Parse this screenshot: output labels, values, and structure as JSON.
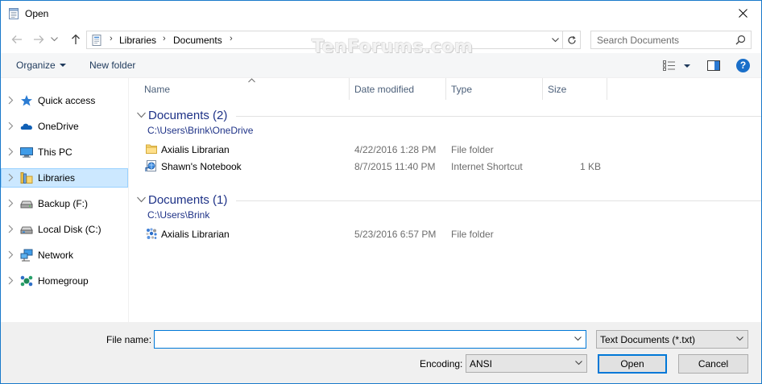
{
  "window": {
    "title": "Open",
    "close_icon": "close-icon"
  },
  "nav": {
    "back_icon": "arrow-left-icon",
    "forward_icon": "arrow-right-icon",
    "recent_icon": "chevron-down-icon",
    "up_icon": "arrow-up-icon",
    "breadcrumb": [
      "Libraries",
      "Documents"
    ],
    "refresh_icon": "refresh-icon",
    "search_placeholder": "Search Documents"
  },
  "watermark": "TenForums.com",
  "toolbar": {
    "organize": "Organize",
    "new_folder": "New folder"
  },
  "sidebar": {
    "items": [
      {
        "label": "Quick access",
        "icon": "star-icon"
      },
      {
        "label": "OneDrive",
        "icon": "cloud-icon"
      },
      {
        "label": "This PC",
        "icon": "computer-icon"
      },
      {
        "label": "Libraries",
        "icon": "library-icon",
        "selected": true
      },
      {
        "label": "Backup (F:)",
        "icon": "drive-icon"
      },
      {
        "label": "Local Disk (C:)",
        "icon": "drive-icon"
      },
      {
        "label": "Network",
        "icon": "network-icon"
      },
      {
        "label": "Homegroup",
        "icon": "homegroup-icon"
      }
    ]
  },
  "columns": [
    "Name",
    "Date modified",
    "Type",
    "Size"
  ],
  "groups": [
    {
      "title": "Documents (2)",
      "path": "C:\\Users\\Brink\\OneDrive",
      "rows": [
        {
          "name": "Axialis Librarian",
          "date": "4/22/2016 1:28 PM",
          "type": "File folder",
          "size": "",
          "icon": "folder-icon"
        },
        {
          "name": "Shawn's Notebook",
          "date": "8/7/2015 11:40 PM",
          "type": "Internet Shortcut",
          "size": "1 KB",
          "icon": "internet-shortcut-icon"
        }
      ]
    },
    {
      "title": "Documents (1)",
      "path": "C:\\Users\\Brink",
      "rows": [
        {
          "name": "Axialis Librarian",
          "date": "5/23/2016 6:57 PM",
          "type": "File folder",
          "size": "",
          "icon": "axialis-icon"
        }
      ]
    }
  ],
  "footer": {
    "file_name_label": "File name:",
    "file_name_value": "",
    "file_type": "Text Documents (*.txt)",
    "encoding_label": "Encoding:",
    "encoding": "ANSI",
    "open_button": "Open",
    "cancel_button": "Cancel"
  },
  "colors": {
    "accent": "#0078d7",
    "selected_bg": "#cce8ff",
    "group_title": "#1e3287"
  }
}
